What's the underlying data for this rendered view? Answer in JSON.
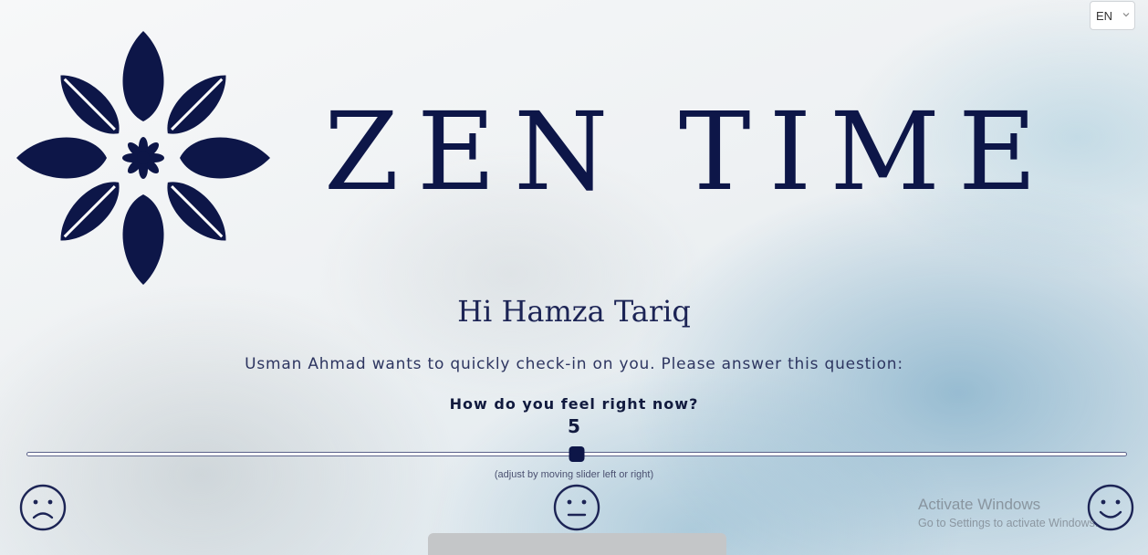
{
  "header": {
    "language": "EN",
    "language_icon": "chevron-down-icon"
  },
  "brand": {
    "logo_icon": "lotus-flower-icon",
    "name": "ZEN TIME",
    "color": "#0d1648"
  },
  "checkin": {
    "greeting": "Hi Hamza Tariq",
    "intro": "Usman Ahmad wants to quickly check-in on you. Please answer this question:",
    "question": "How do you feel right now?",
    "value": "5",
    "slider": {
      "min": 0,
      "max": 10,
      "value": 5
    },
    "hint": "(adjust by moving slider left or right)",
    "faces": {
      "low": "sad-face-icon",
      "mid": "neutral-face-icon",
      "high": "happy-face-icon"
    }
  },
  "watermark": {
    "title": "Activate Windows",
    "subtitle": "Go to Settings to activate Windows."
  },
  "colors": {
    "primary": "#0d1648",
    "track": "#5b628a",
    "submit": "#c4c6c8"
  }
}
